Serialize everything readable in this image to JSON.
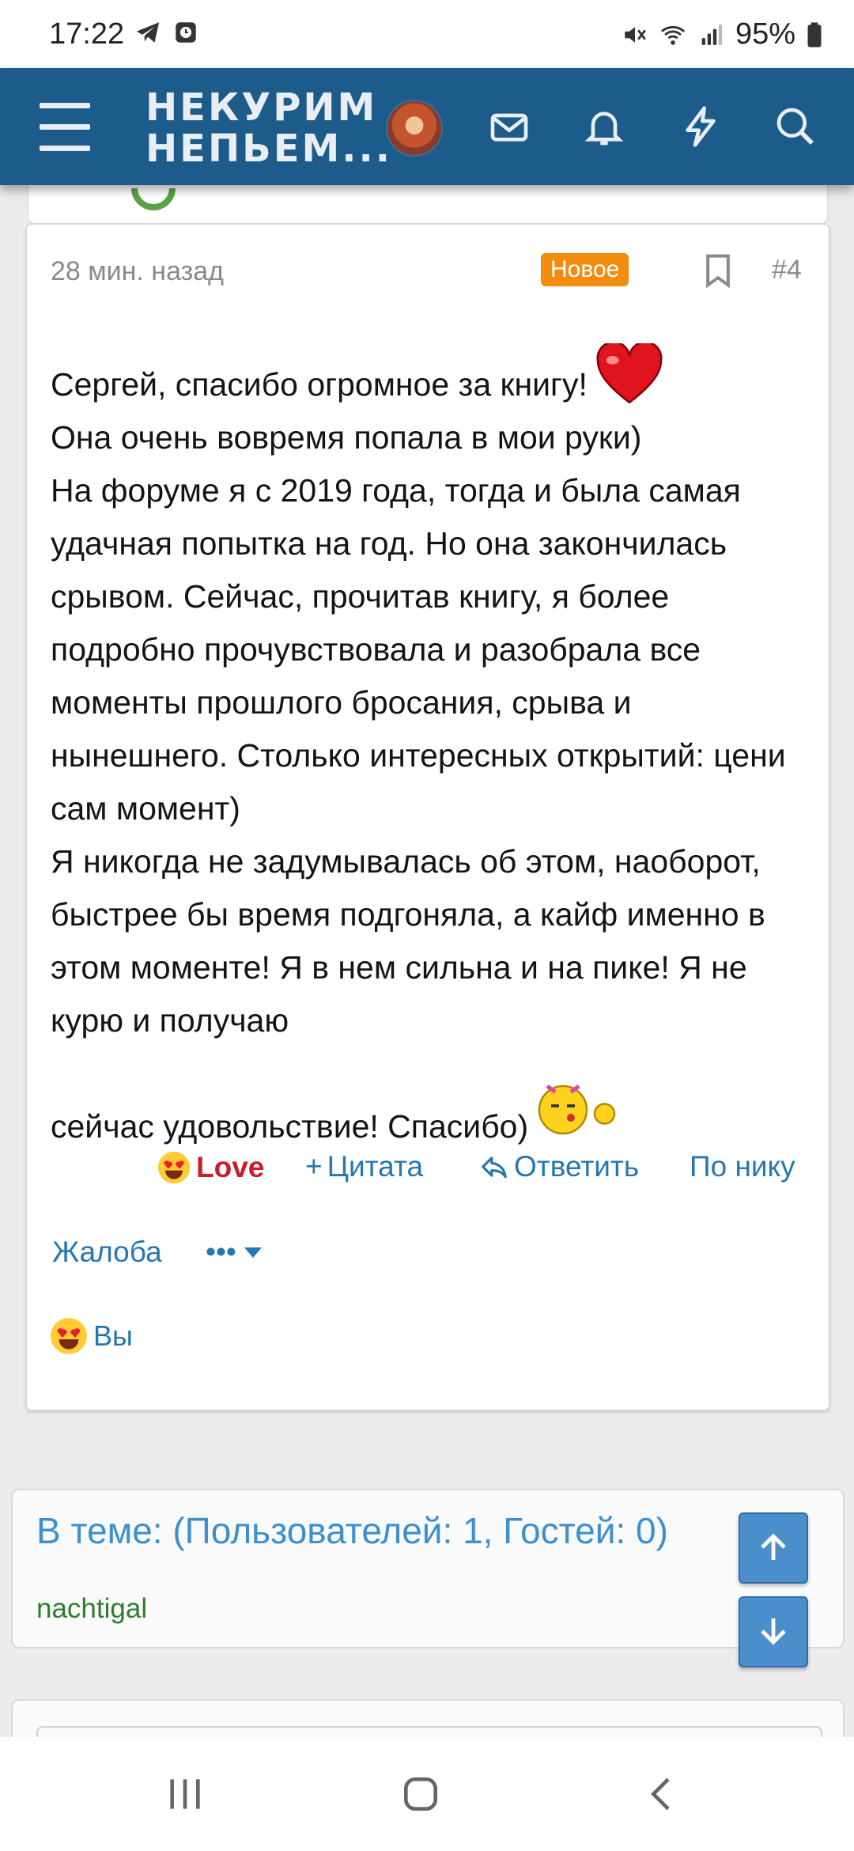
{
  "status_bar": {
    "time": "17:22",
    "battery": "95%",
    "icons": [
      "telegram-icon",
      "alarm-icon",
      "mute-icon",
      "wifi-icon",
      "signal-icon",
      "battery-icon"
    ]
  },
  "header": {
    "logo_line1": "НЕКУРИМ",
    "logo_line2": "НЕПЬЕМ...",
    "icons": [
      "menu-icon",
      "avatar",
      "mail-icon",
      "bell-icon",
      "lightning-icon",
      "search-icon"
    ],
    "color": "#1d5b8a"
  },
  "post": {
    "time": "28 мин. назад",
    "badge": "Новое",
    "number": "#4",
    "paragraphs": [
      "Сергей, спасибо огромное за книгу!",
      "Она очень вовремя попала в мои руки)",
      "На форуме я с 2019 года, тогда и была самая удачная попытка на год. Но она закончилась срывом. Сейчас, прочитав книгу, я более подробно прочувствовала и разобрала все моменты прошлого бросания, срыва и нынешнего. Столько интересных открытий: цени сам момент)",
      "Я никогда не задумывалась об этом, наоборот, быстрее бы время подгоняла, а кайф именно в этом моменте! Я в нем сильна и на пике! Я не курю и получаю",
      "сейчас удовольствие! Спасибо)"
    ],
    "actions": {
      "love": "Love",
      "quote": "Цитата",
      "reply": "Ответить",
      "by_nick": "По нику",
      "report": "Жалоба",
      "more": "•••"
    },
    "reactions_by": "Вы"
  },
  "online": {
    "title": "В теме: (Пользователей: 1, Гостей: 0)",
    "users": [
      "nachtigal"
    ]
  },
  "colors": {
    "link": "#2577b1",
    "badge": "#f28c0f",
    "love": "#c61e2a",
    "online_user": "#2e7d32"
  }
}
